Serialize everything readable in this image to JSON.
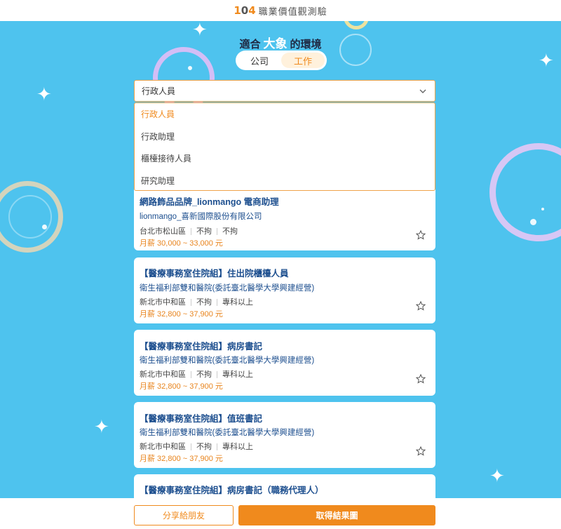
{
  "header": {
    "logo_prefix": "1",
    "logo_zero": "0",
    "logo_suffix": "4",
    "title": "職業價值觀測驗"
  },
  "heading": {
    "prefix": "適合",
    "highlight": "大象",
    "suffix": "的環境"
  },
  "toggle": {
    "options": [
      "公司",
      "工作"
    ],
    "active": "工作"
  },
  "select": {
    "value": "行政人員",
    "options": [
      "行政人員",
      "行政助理",
      "櫃檯接待人員",
      "研究助理"
    ],
    "selected": "行政人員"
  },
  "jobs": [
    {
      "title": "網路飾品品牌_lionmango 電商助理",
      "company": "lionmango_喜新國際股份有限公司",
      "location": "台北市松山區",
      "experience": "不拘",
      "education": "不拘",
      "salary": "月薪 30,000 ~ 33,000 元"
    },
    {
      "title": "【醫療事務室住院組】住出院櫃檯人員",
      "company": "衛生福利部雙和醫院(委託臺北醫學大學興建經營)",
      "location": "新北市中和區",
      "experience": "不拘",
      "education": "專科以上",
      "salary": "月薪 32,800 ~ 37,900 元"
    },
    {
      "title": "【醫療事務室住院組】病房書記",
      "company": "衛生福利部雙和醫院(委託臺北醫學大學興建經營)",
      "location": "新北市中和區",
      "experience": "不拘",
      "education": "專科以上",
      "salary": "月薪 32,800 ~ 37,900 元"
    },
    {
      "title": "【醫療事務室住院組】值班書記",
      "company": "衛生福利部雙和醫院(委託臺北醫學大學興建經營)",
      "location": "新北市中和區",
      "experience": "不拘",
      "education": "專科以上",
      "salary": "月薪 32,800 ~ 37,900 元"
    },
    {
      "title": "【醫療事務室住院組】病房書記（職務代理人）"
    }
  ],
  "footer": {
    "share_label": "分享給朋友",
    "result_label": "取得結果圖"
  },
  "colors": {
    "accent": "#f08a1d",
    "background": "#4ec3ee",
    "link": "#1d4f8f"
  },
  "icons": {
    "select_arrow": "chevron-down-icon",
    "favorite": "star-outline-icon"
  }
}
